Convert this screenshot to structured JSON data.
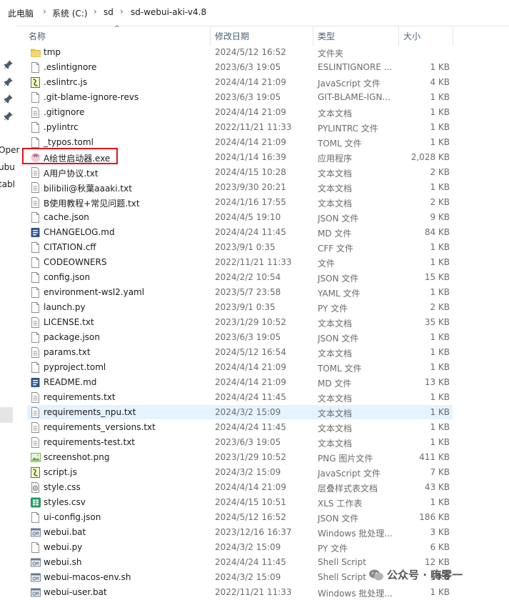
{
  "breadcrumb": {
    "items": [
      "此电脑",
      "系统 (C:)",
      "sd",
      "sd-webui-aki-v4.8"
    ]
  },
  "nav": {
    "partial_labels": [
      "Oper",
      "ubu",
      "tabl"
    ]
  },
  "columns": {
    "name": "名称",
    "modified": "修改日期",
    "type": "类型",
    "size": "大小"
  },
  "files": [
    {
      "name": "tmp",
      "modified": "2024/5/12 16:52",
      "type": "文件夹",
      "size": "",
      "icon": "folder-icon"
    },
    {
      "name": ".eslintignore",
      "modified": "2023/6/3 19:05",
      "type": "ESLINTIGNORE ...",
      "size": "1 KB",
      "icon": "file-icon"
    },
    {
      "name": ".eslintrc.js",
      "modified": "2024/4/14 21:09",
      "type": "JavaScript 文件",
      "size": "4 KB",
      "icon": "script-icon"
    },
    {
      "name": ".git-blame-ignore-revs",
      "modified": "2023/6/3 19:05",
      "type": "GIT-BLAME-IGN...",
      "size": "1 KB",
      "icon": "file-icon"
    },
    {
      "name": ".gitignore",
      "modified": "2024/4/14 21:09",
      "type": "文本文档",
      "size": "1 KB",
      "icon": "text-file-icon"
    },
    {
      "name": ".pylintrc",
      "modified": "2022/11/21 11:33",
      "type": "PYLINTRC 文件",
      "size": "1 KB",
      "icon": "file-icon"
    },
    {
      "name": "_typos.toml",
      "modified": "2024/4/14 21:09",
      "type": "TOML 文件",
      "size": "1 KB",
      "icon": "file-icon"
    },
    {
      "name": "A绘世启动器.exe",
      "modified": "2024/1/14 16:39",
      "type": "应用程序",
      "size": "2,028 KB",
      "icon": "app-icon"
    },
    {
      "name": "A用户协议.txt",
      "modified": "2024/4/15 10:28",
      "type": "文本文档",
      "size": "2 KB",
      "icon": "text-file-icon"
    },
    {
      "name": "bilibili@秋葉aaaki.txt",
      "modified": "2023/9/30 20:21",
      "type": "文本文档",
      "size": "1 KB",
      "icon": "text-file-icon"
    },
    {
      "name": "B使用教程+常见问题.txt",
      "modified": "2024/1/16 17:55",
      "type": "文本文档",
      "size": "2 KB",
      "icon": "text-file-icon"
    },
    {
      "name": "cache.json",
      "modified": "2024/4/5 19:10",
      "type": "JSON 文件",
      "size": "9 KB",
      "icon": "file-icon"
    },
    {
      "name": "CHANGELOG.md",
      "modified": "2024/4/24 11:45",
      "type": "MD 文件",
      "size": "84 KB",
      "icon": "markdown-icon"
    },
    {
      "name": "CITATION.cff",
      "modified": "2023/9/1 0:35",
      "type": "CFF 文件",
      "size": "1 KB",
      "icon": "file-icon"
    },
    {
      "name": "CODEOWNERS",
      "modified": "2022/11/21 11:33",
      "type": "文件",
      "size": "1 KB",
      "icon": "file-icon"
    },
    {
      "name": "config.json",
      "modified": "2024/2/2 10:54",
      "type": "JSON 文件",
      "size": "15 KB",
      "icon": "file-icon"
    },
    {
      "name": "environment-wsl2.yaml",
      "modified": "2023/5/7 23:58",
      "type": "YAML 文件",
      "size": "1 KB",
      "icon": "file-icon"
    },
    {
      "name": "launch.py",
      "modified": "2023/9/1 0:35",
      "type": "PY 文件",
      "size": "2 KB",
      "icon": "file-icon"
    },
    {
      "name": "LICENSE.txt",
      "modified": "2023/1/29 10:52",
      "type": "文本文档",
      "size": "35 KB",
      "icon": "text-file-icon"
    },
    {
      "name": "package.json",
      "modified": "2023/6/3 19:05",
      "type": "JSON 文件",
      "size": "1 KB",
      "icon": "file-icon"
    },
    {
      "name": "params.txt",
      "modified": "2024/5/12 16:54",
      "type": "文本文档",
      "size": "1 KB",
      "icon": "text-file-icon"
    },
    {
      "name": "pyproject.toml",
      "modified": "2024/4/14 21:09",
      "type": "TOML 文件",
      "size": "1 KB",
      "icon": "file-icon"
    },
    {
      "name": "README.md",
      "modified": "2024/4/14 21:09",
      "type": "MD 文件",
      "size": "13 KB",
      "icon": "markdown-icon"
    },
    {
      "name": "requirements.txt",
      "modified": "2024/4/24 11:45",
      "type": "文本文档",
      "size": "1 KB",
      "icon": "text-file-icon"
    },
    {
      "name": "requirements_npu.txt",
      "modified": "2024/3/2 15:09",
      "type": "文本文档",
      "size": "1 KB",
      "icon": "text-file-icon"
    },
    {
      "name": "requirements_versions.txt",
      "modified": "2024/4/24 11:45",
      "type": "文本文档",
      "size": "1 KB",
      "icon": "text-file-icon"
    },
    {
      "name": "requirements-test.txt",
      "modified": "2023/6/3 19:05",
      "type": "文本文档",
      "size": "1 KB",
      "icon": "text-file-icon"
    },
    {
      "name": "screenshot.png",
      "modified": "2023/1/29 10:52",
      "type": "PNG 图片文件",
      "size": "411 KB",
      "icon": "image-icon"
    },
    {
      "name": "script.js",
      "modified": "2024/3/2 15:09",
      "type": "JavaScript 文件",
      "size": "7 KB",
      "icon": "script-icon"
    },
    {
      "name": "style.css",
      "modified": "2024/4/14 21:09",
      "type": "层叠样式表文档",
      "size": "43 KB",
      "icon": "css-icon"
    },
    {
      "name": "styles.csv",
      "modified": "2024/4/15 10:51",
      "type": "XLS 工作表",
      "size": "1 KB",
      "icon": "sheet-icon"
    },
    {
      "name": "ui-config.json",
      "modified": "2024/5/12 16:52",
      "type": "JSON 文件",
      "size": "186 KB",
      "icon": "file-icon"
    },
    {
      "name": "webui.bat",
      "modified": "2023/12/16 16:37",
      "type": "Windows 批处理...",
      "size": "3 KB",
      "icon": "batch-icon"
    },
    {
      "name": "webui.py",
      "modified": "2024/3/2 15:09",
      "type": "PY 文件",
      "size": "6 KB",
      "icon": "file-icon"
    },
    {
      "name": "webui.sh",
      "modified": "2024/4/24 11:45",
      "type": "Shell Script",
      "size": "12 KB",
      "icon": "shell-icon"
    },
    {
      "name": "webui-macos-env.sh",
      "modified": "2024/3/2 15:09",
      "type": "Shell Script",
      "size": "1 KB",
      "icon": "shell-icon"
    },
    {
      "name": "webui-user.bat",
      "modified": "2022/11/21 11:33",
      "type": "Windows 批处理...",
      "size": "1 KB",
      "icon": "batch-icon"
    }
  ],
  "selected_index": 24,
  "highlighted_index": 7,
  "watermark": "公众号 · 嗨零一"
}
